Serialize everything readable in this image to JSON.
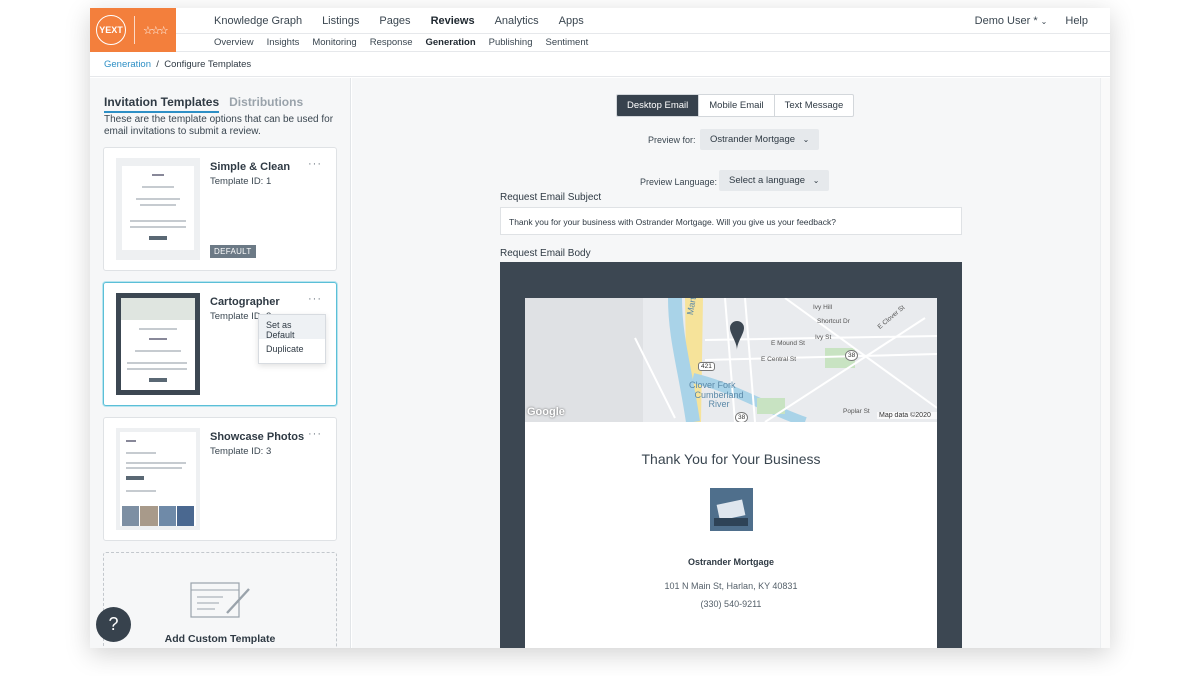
{
  "app": {
    "logo_text": "YEXT",
    "colors": {
      "brand": "#f37f3c",
      "accent": "#2d8fc5",
      "dark": "#37424d"
    }
  },
  "nav": {
    "main": [
      "Knowledge Graph",
      "Listings",
      "Pages",
      "Reviews",
      "Analytics",
      "Apps"
    ],
    "active_main": "Reviews",
    "sub": [
      "Overview",
      "Insights",
      "Monitoring",
      "Response",
      "Generation",
      "Publishing",
      "Sentiment"
    ],
    "active_sub": "Generation",
    "user": "Demo User *",
    "help": "Help"
  },
  "breadcrumb": {
    "parent": "Generation",
    "separator": "/",
    "current": "Configure Templates"
  },
  "left": {
    "tabs": [
      "Invitation Templates",
      "Distributions"
    ],
    "description": "These are the template options that can be used for email invitations to submit a review.",
    "templates": [
      {
        "name": "Simple & Clean",
        "id_label": "Template ID: 1",
        "badge": "DEFAULT"
      },
      {
        "name": "Cartographer",
        "id_label": "Template ID: 2"
      },
      {
        "name": "Showcase Photos",
        "id_label": "Template ID: 3"
      }
    ],
    "menu": [
      "Set as Default",
      "Duplicate"
    ],
    "add_custom": "Add Custom Template",
    "help_glyph": "?"
  },
  "right": {
    "preview_tabs": [
      "Desktop Email",
      "Mobile Email",
      "Text Message"
    ],
    "preview_for_label": "Preview for:",
    "preview_for_value": "Ostrander Mortgage",
    "preview_language_label": "Preview Language:",
    "preview_language_value": "Select a language",
    "subject_label": "Request Email Subject",
    "subject_value": "Thank you for your business with Ostrander Mortgage. Will you give us your feedback?",
    "body_label": "Request Email Body",
    "email": {
      "map_labels": [
        "Martins Fork",
        "Clover Fork",
        "Cumberland River",
        "E Mound St",
        "E Central St",
        "E Clover St",
        "Ivy St",
        "Shortcut Dr",
        "Ivy Hill",
        "Poplar St"
      ],
      "map_badges": [
        "421",
        "38",
        "38"
      ],
      "google": "Google",
      "map_data": "Map data ©2020",
      "heading": "Thank You for Your Business",
      "business": "Ostrander Mortgage",
      "address": "101 N Main St, Harlan, KY 40831",
      "phone": "(330) 540-9211"
    }
  }
}
